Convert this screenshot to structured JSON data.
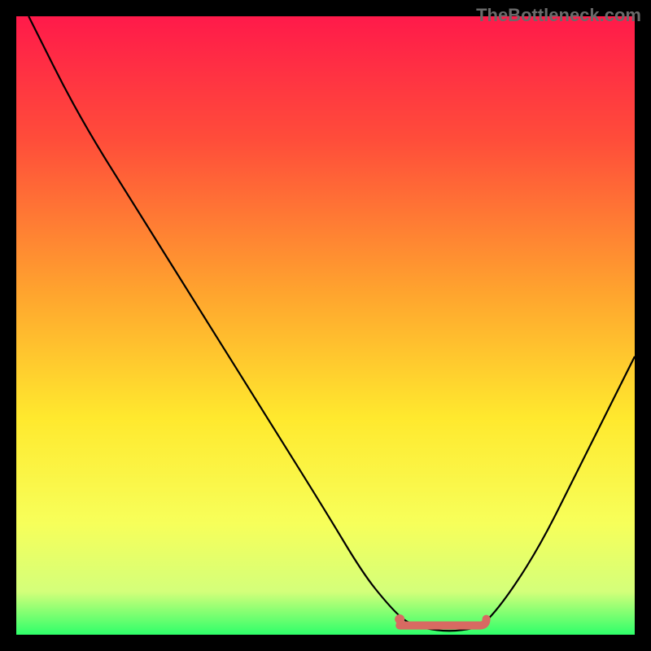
{
  "watermark": "TheBottleneck.com",
  "chart_data": {
    "type": "line",
    "title": "",
    "xlabel": "",
    "ylabel": "",
    "xlim": [
      0,
      100
    ],
    "ylim": [
      0,
      100
    ],
    "gradient_stops": [
      {
        "offset": 0,
        "color": "#ff1a4a"
      },
      {
        "offset": 20,
        "color": "#ff4d3a"
      },
      {
        "offset": 45,
        "color": "#ffa52e"
      },
      {
        "offset": 65,
        "color": "#ffe92e"
      },
      {
        "offset": 82,
        "color": "#f7ff5a"
      },
      {
        "offset": 93,
        "color": "#d4ff7a"
      },
      {
        "offset": 100,
        "color": "#2eff6a"
      }
    ],
    "series": [
      {
        "name": "bottleneck-curve",
        "color": "#000000",
        "x": [
          2,
          10,
          20,
          30,
          40,
          50,
          56,
          60,
          63,
          66,
          70,
          74,
          76,
          80,
          85,
          90,
          95,
          100
        ],
        "y": [
          100,
          84,
          68,
          52,
          36,
          20,
          10,
          5,
          2,
          1,
          0.5,
          1,
          2,
          7,
          15,
          25,
          35,
          45
        ]
      }
    ],
    "highlight_band": {
      "name": "optimal-range",
      "color": "#d86a62",
      "x_start": 62,
      "x_end": 76,
      "y": 1.5,
      "dot_x": 62,
      "dot_y": 2.5
    }
  }
}
